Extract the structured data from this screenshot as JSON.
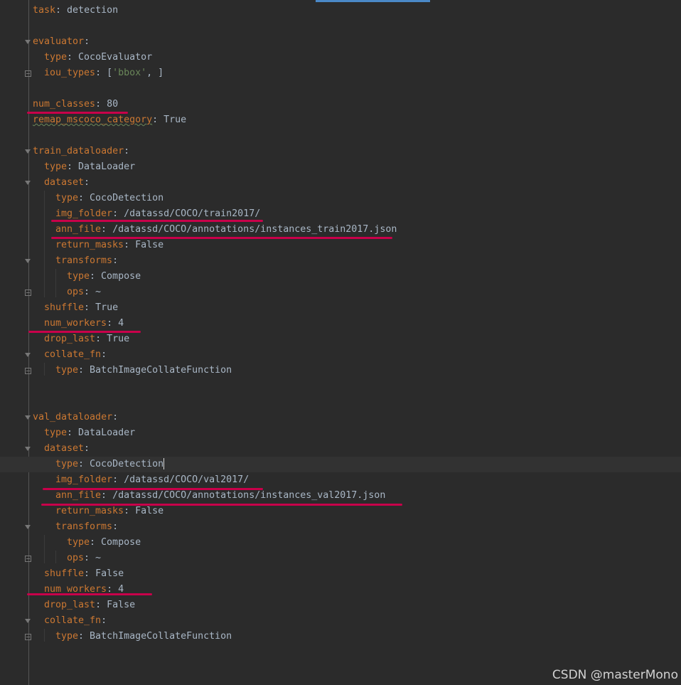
{
  "editor": {
    "lines": [
      {
        "indent": 0,
        "key": "task",
        "sep": ": ",
        "value": "detection"
      },
      {
        "indent": 0,
        "key": "",
        "sep": "",
        "value": ""
      },
      {
        "indent": 0,
        "key": "evaluator",
        "sep": ":",
        "value": ""
      },
      {
        "indent": 1,
        "key": "type",
        "sep": ": ",
        "value": "CocoEvaluator"
      },
      {
        "indent": 1,
        "key": "iou_types",
        "sep": ": ",
        "value_prefix": "[",
        "value_string": "'bbox'",
        "value_suffix": ", ]"
      },
      {
        "indent": 0,
        "key": "",
        "sep": "",
        "value": ""
      },
      {
        "indent": 0,
        "key": "num_classes",
        "sep": ": ",
        "value": "80"
      },
      {
        "indent": 0,
        "key": "remap_mscoco_category",
        "sep": ": ",
        "value": "True"
      },
      {
        "indent": 0,
        "key": "",
        "sep": "",
        "value": ""
      },
      {
        "indent": 0,
        "key": "train_dataloader",
        "sep": ":",
        "value": ""
      },
      {
        "indent": 1,
        "key": "type",
        "sep": ": ",
        "value": "DataLoader"
      },
      {
        "indent": 1,
        "key": "dataset",
        "sep": ":",
        "value": ""
      },
      {
        "indent": 2,
        "key": "type",
        "sep": ": ",
        "value": "CocoDetection"
      },
      {
        "indent": 2,
        "key": "img_folder",
        "sep": ": ",
        "value": "/datassd/COCO/train2017/"
      },
      {
        "indent": 2,
        "key": "ann_file",
        "sep": ": ",
        "value": "/datassd/COCO/annotations/instances_train2017.json"
      },
      {
        "indent": 2,
        "key": "return_masks",
        "sep": ": ",
        "value": "False"
      },
      {
        "indent": 2,
        "key": "transforms",
        "sep": ":",
        "value": ""
      },
      {
        "indent": 3,
        "key": "type",
        "sep": ": ",
        "value": "Compose"
      },
      {
        "indent": 3,
        "key": "ops",
        "sep": ": ",
        "value": "~"
      },
      {
        "indent": 1,
        "key": "shuffle",
        "sep": ": ",
        "value": "True"
      },
      {
        "indent": 1,
        "key": "num_workers",
        "sep": ": ",
        "value": "4"
      },
      {
        "indent": 1,
        "key": "drop_last",
        "sep": ": ",
        "value": "True"
      },
      {
        "indent": 1,
        "key": "collate_fn",
        "sep": ":",
        "value": ""
      },
      {
        "indent": 2,
        "key": "type",
        "sep": ": ",
        "value": "BatchImageCollateFunction"
      },
      {
        "indent": 0,
        "key": "",
        "sep": "",
        "value": ""
      },
      {
        "indent": 0,
        "key": "",
        "sep": "",
        "value": ""
      },
      {
        "indent": 0,
        "key": "val_dataloader",
        "sep": ":",
        "value": ""
      },
      {
        "indent": 1,
        "key": "type",
        "sep": ": ",
        "value": "DataLoader"
      },
      {
        "indent": 1,
        "key": "dataset",
        "sep": ":",
        "value": ""
      },
      {
        "indent": 2,
        "key": "type",
        "sep": ": ",
        "value": "CocoDetection"
      },
      {
        "indent": 2,
        "key": "img_folder",
        "sep": ": ",
        "value": "/datassd/COCO/val2017/"
      },
      {
        "indent": 2,
        "key": "ann_file",
        "sep": ": ",
        "value": "/datassd/COCO/annotations/instances_val2017.json"
      },
      {
        "indent": 2,
        "key": "return_masks",
        "sep": ": ",
        "value": "False"
      },
      {
        "indent": 2,
        "key": "transforms",
        "sep": ":",
        "value": ""
      },
      {
        "indent": 3,
        "key": "type",
        "sep": ": ",
        "value": "Compose"
      },
      {
        "indent": 3,
        "key": "ops",
        "sep": ": ",
        "value": "~"
      },
      {
        "indent": 1,
        "key": "shuffle",
        "sep": ": ",
        "value": "False"
      },
      {
        "indent": 1,
        "key": "num_workers",
        "sep": ": ",
        "value": "4"
      },
      {
        "indent": 1,
        "key": "drop_last",
        "sep": ": ",
        "value": "False"
      },
      {
        "indent": 1,
        "key": "collate_fn",
        "sep": ":",
        "value": ""
      },
      {
        "indent": 2,
        "key": "type",
        "sep": ": ",
        "value": "BatchImageCollateFunction"
      }
    ]
  },
  "watermark": "CSDN @masterMono",
  "colors": {
    "background": "#2b2b2b",
    "key": "#cc7832",
    "value": "#a9b7c6",
    "string": "#6a8759",
    "annotation_marker": "#c8004a"
  }
}
